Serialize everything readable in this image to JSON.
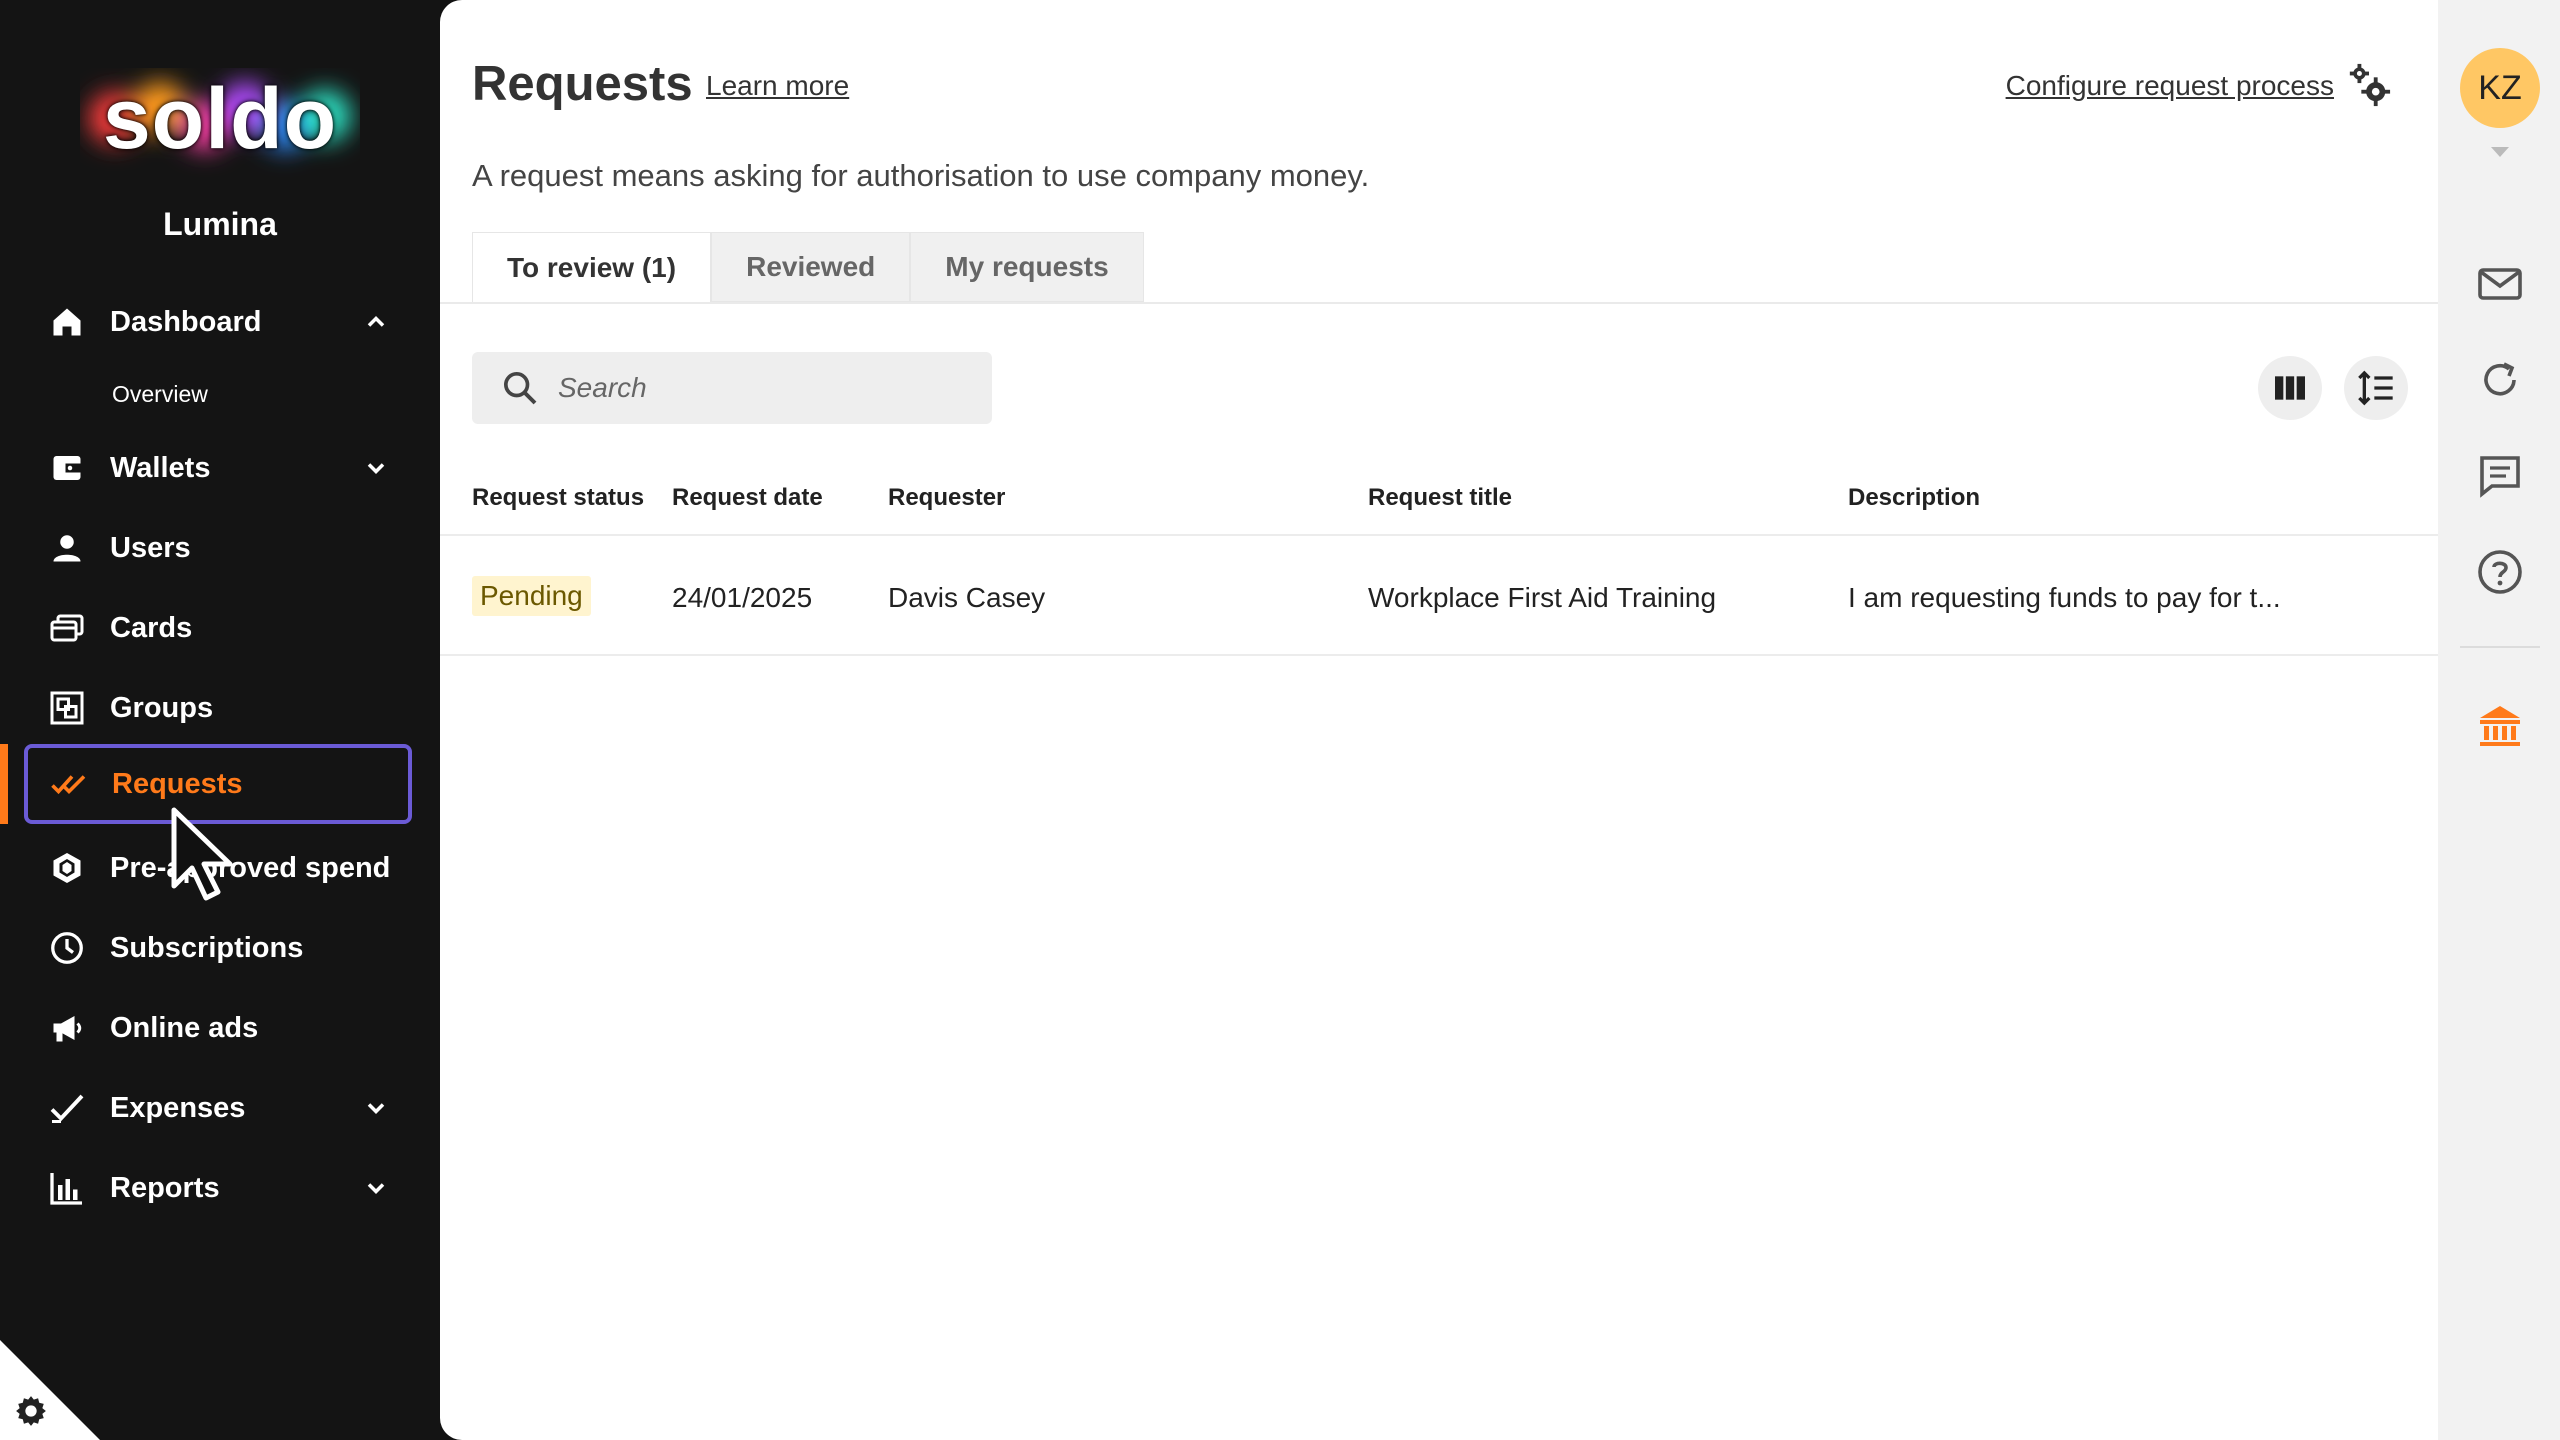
{
  "brand": {
    "logo_text": "soldo",
    "company_name": "Lumina"
  },
  "sidebar": {
    "items": [
      {
        "label": "Dashboard",
        "icon": "home-icon",
        "expanded": true,
        "sub": [
          "Overview"
        ]
      },
      {
        "label": "Wallets",
        "icon": "wallet-icon",
        "expanded": false
      },
      {
        "label": "Users",
        "icon": "user-icon"
      },
      {
        "label": "Cards",
        "icon": "cards-icon"
      },
      {
        "label": "Groups",
        "icon": "groups-icon"
      },
      {
        "label": "Requests",
        "icon": "double-check-icon",
        "active": true
      },
      {
        "label": "Pre-approved spend",
        "icon": "hexagon-icon"
      },
      {
        "label": "Subscriptions",
        "icon": "clock-icon"
      },
      {
        "label": "Online ads",
        "icon": "megaphone-icon"
      },
      {
        "label": "Expenses",
        "icon": "check-icon",
        "expanded": false
      },
      {
        "label": "Reports",
        "icon": "bar-chart-icon",
        "expanded": false
      }
    ]
  },
  "header": {
    "title": "Requests",
    "learn_more": "Learn more",
    "configure": "Configure request process",
    "subtitle": "A request means asking for authorisation to use company money."
  },
  "tabs": [
    {
      "label": "To review (1)",
      "active": true
    },
    {
      "label": "Reviewed",
      "active": false
    },
    {
      "label": "My requests",
      "active": false
    }
  ],
  "search": {
    "placeholder": "Search",
    "value": ""
  },
  "table": {
    "columns": [
      "Request status",
      "Request date",
      "Requester",
      "Request title",
      "Description"
    ],
    "rows": [
      {
        "status": "Pending",
        "date": "24/01/2025",
        "requester": "Davis Casey",
        "title": "Workplace First Aid Training",
        "description": "I am requesting funds to pay for t..."
      }
    ]
  },
  "rail": {
    "avatar_initials": "KZ",
    "icons": [
      "mail-icon",
      "refresh-icon",
      "chat-icon",
      "help-icon",
      "bank-icon"
    ]
  },
  "colors": {
    "accent": "#ff7a1a",
    "active_outline": "#6b5bd6",
    "avatar": "#ffc764",
    "pending_badge": "#fff4cf"
  }
}
